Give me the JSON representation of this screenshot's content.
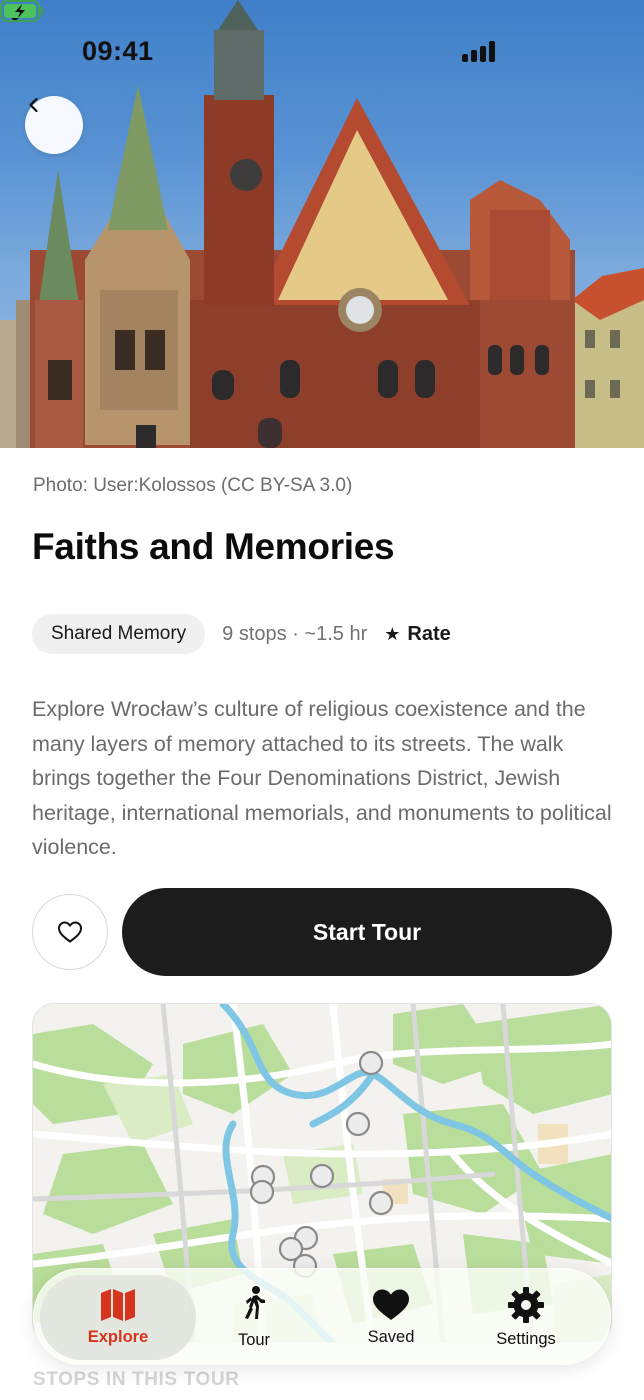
{
  "status_bar": {
    "time": "09:41"
  },
  "hero": {
    "photo_credit": "Photo: User:Kolossos (CC BY-SA 3.0)"
  },
  "tour": {
    "title": "Faiths and Memories",
    "category_chip": "Shared Memory",
    "stops_duration": "9 stops · ~1.5 hr",
    "rate_icon": "star-icon",
    "rate_label": "Rate",
    "description": "Explore Wrocław’s culture of religious coexistence and the many layers of memory attached to its streets. The walk brings together the Four Denominations District, Jewish heritage, international memorials, and monuments to political violence."
  },
  "actions": {
    "favorite_icon": "heart-outline-icon",
    "start_label": "Start Tour"
  },
  "map": {
    "marker_count_visible": 10
  },
  "sections": {
    "stops_heading": "STOPS IN THIS TOUR"
  },
  "tabbar": {
    "active_color": "#d6341c",
    "tabs": [
      {
        "label": "Explore",
        "icon": "map-icon",
        "active": true
      },
      {
        "label": "Tour",
        "icon": "walking-icon",
        "active": false
      },
      {
        "label": "Saved",
        "icon": "heart-icon",
        "active": false
      },
      {
        "label": "Settings",
        "icon": "gear-icon",
        "active": false
      }
    ]
  }
}
